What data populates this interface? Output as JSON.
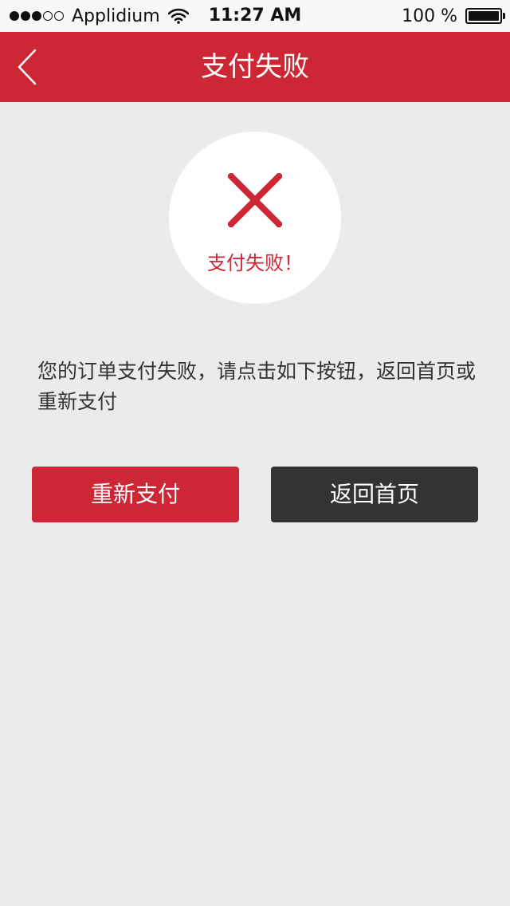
{
  "status_bar": {
    "carrier": "Applidium",
    "time": "11:27 AM",
    "battery": "100 %",
    "signal_icon": "signal-dots-icon",
    "wifi_icon": "wifi-icon",
    "battery_icon": "battery-icon"
  },
  "nav": {
    "title": "支付失败",
    "back_icon": "chevron-left-icon"
  },
  "status_circle": {
    "icon": "x-icon",
    "label": "支付失败！"
  },
  "message": "您的订单支付失败，请点击如下按钮，返回首页或重新支付",
  "buttons": {
    "repay": "重新支付",
    "home": "返回首页"
  },
  "colors": {
    "brand_red": "#cd2736",
    "dark_button": "#333333",
    "background": "#ebebeb"
  }
}
